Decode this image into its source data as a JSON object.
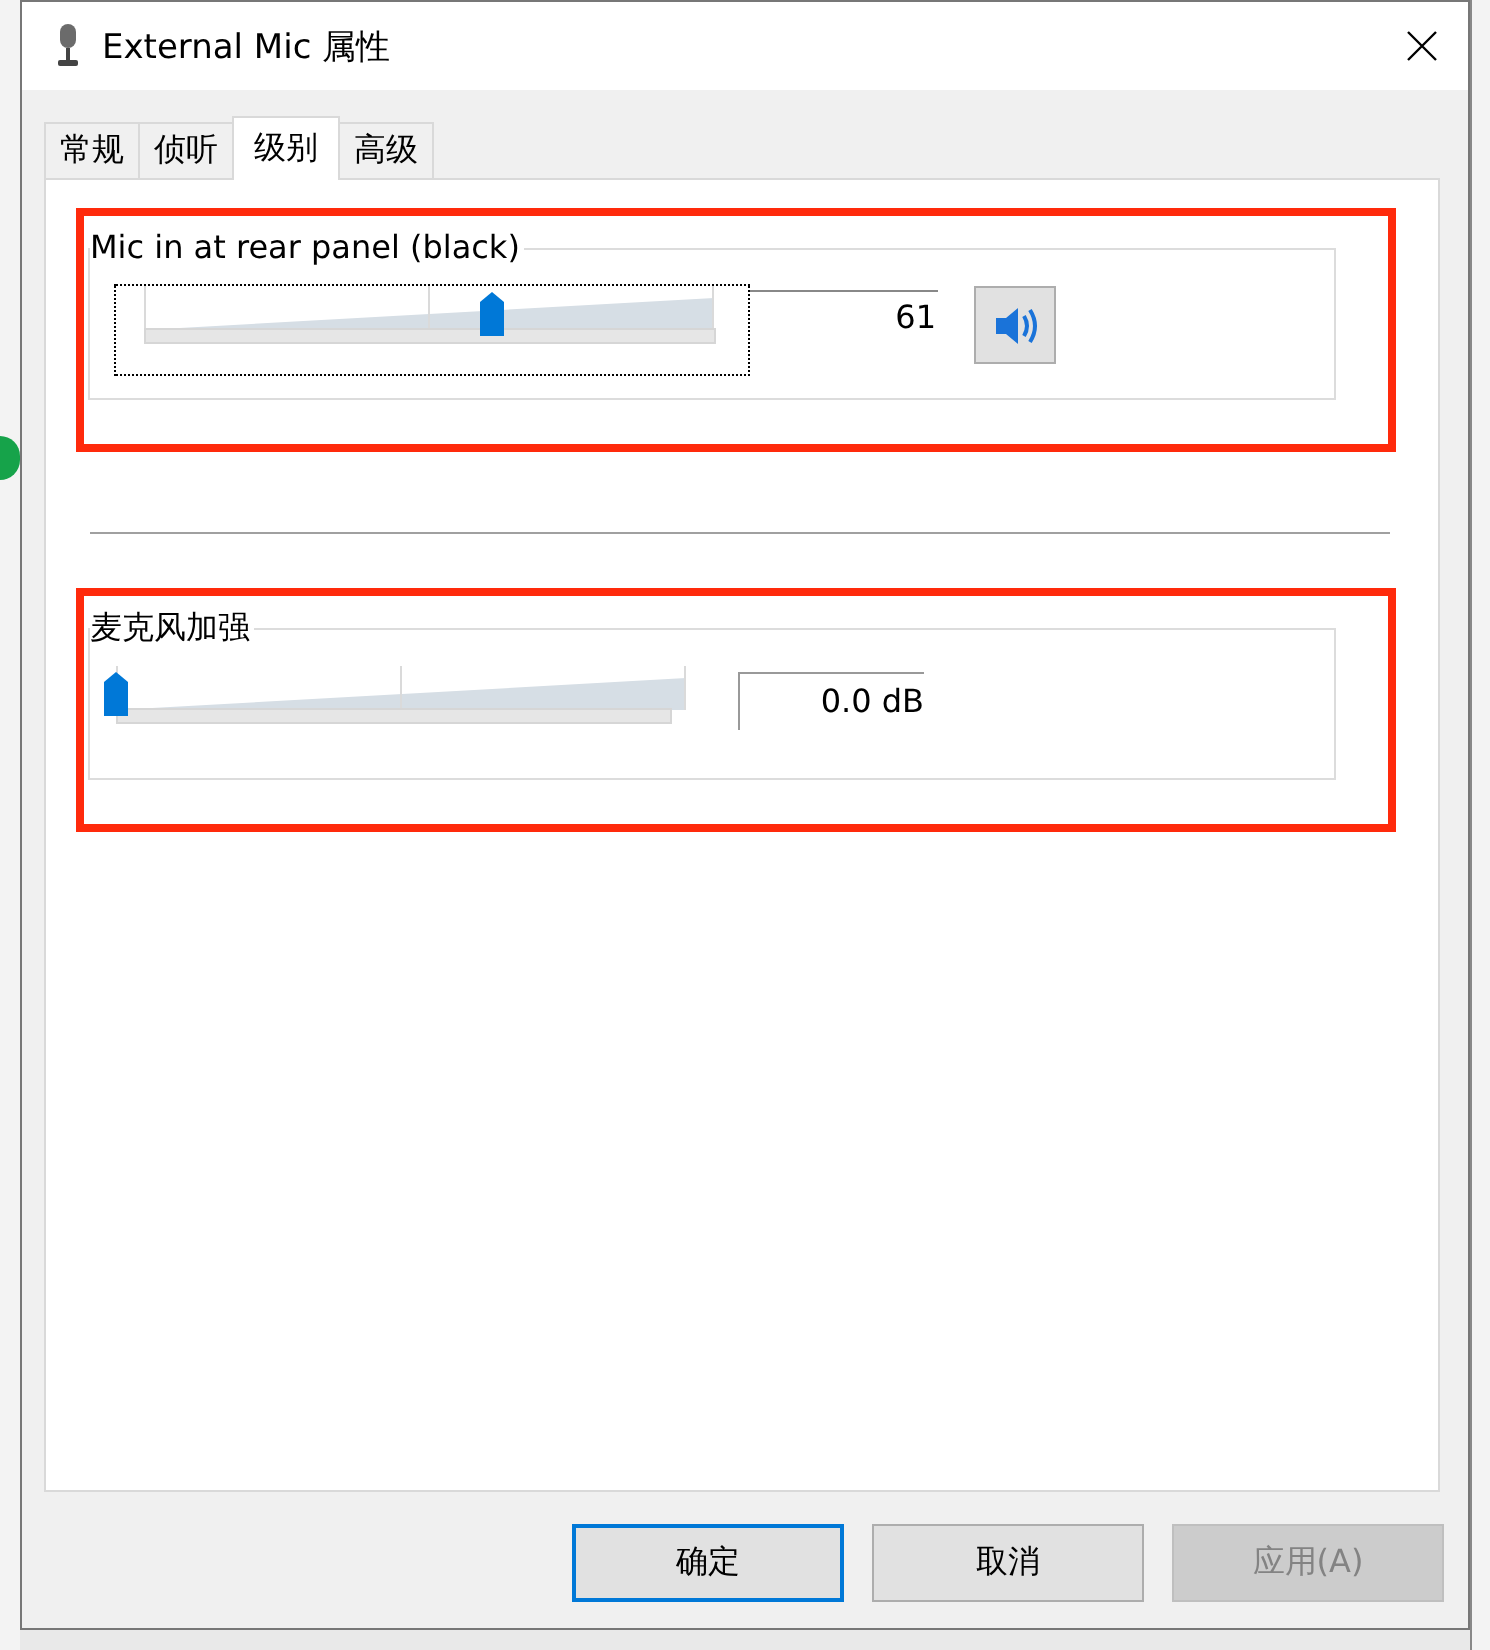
{
  "window": {
    "title": "External Mic 属性"
  },
  "tabs": [
    {
      "label": "常规",
      "selected": false
    },
    {
      "label": "侦听",
      "selected": false
    },
    {
      "label": "级别",
      "selected": true
    },
    {
      "label": "高级",
      "selected": false
    }
  ],
  "levels": [
    {
      "kind": "volume",
      "label": "Mic in at rear panel (black)",
      "level": 0.61,
      "reading": "61",
      "focused": true,
      "highlighted": true
    },
    {
      "kind": "boost",
      "label": "麦克风加强",
      "level": 0,
      "reading": "0.0 dB",
      "focused": false,
      "highlighted": true
    }
  ],
  "buttons": [
    {
      "label": "确定",
      "default": true,
      "disabled": false
    },
    {
      "label": "取消",
      "default": false,
      "disabled": false
    },
    {
      "label": "应用(A)",
      "default": false,
      "disabled": true
    }
  ]
}
